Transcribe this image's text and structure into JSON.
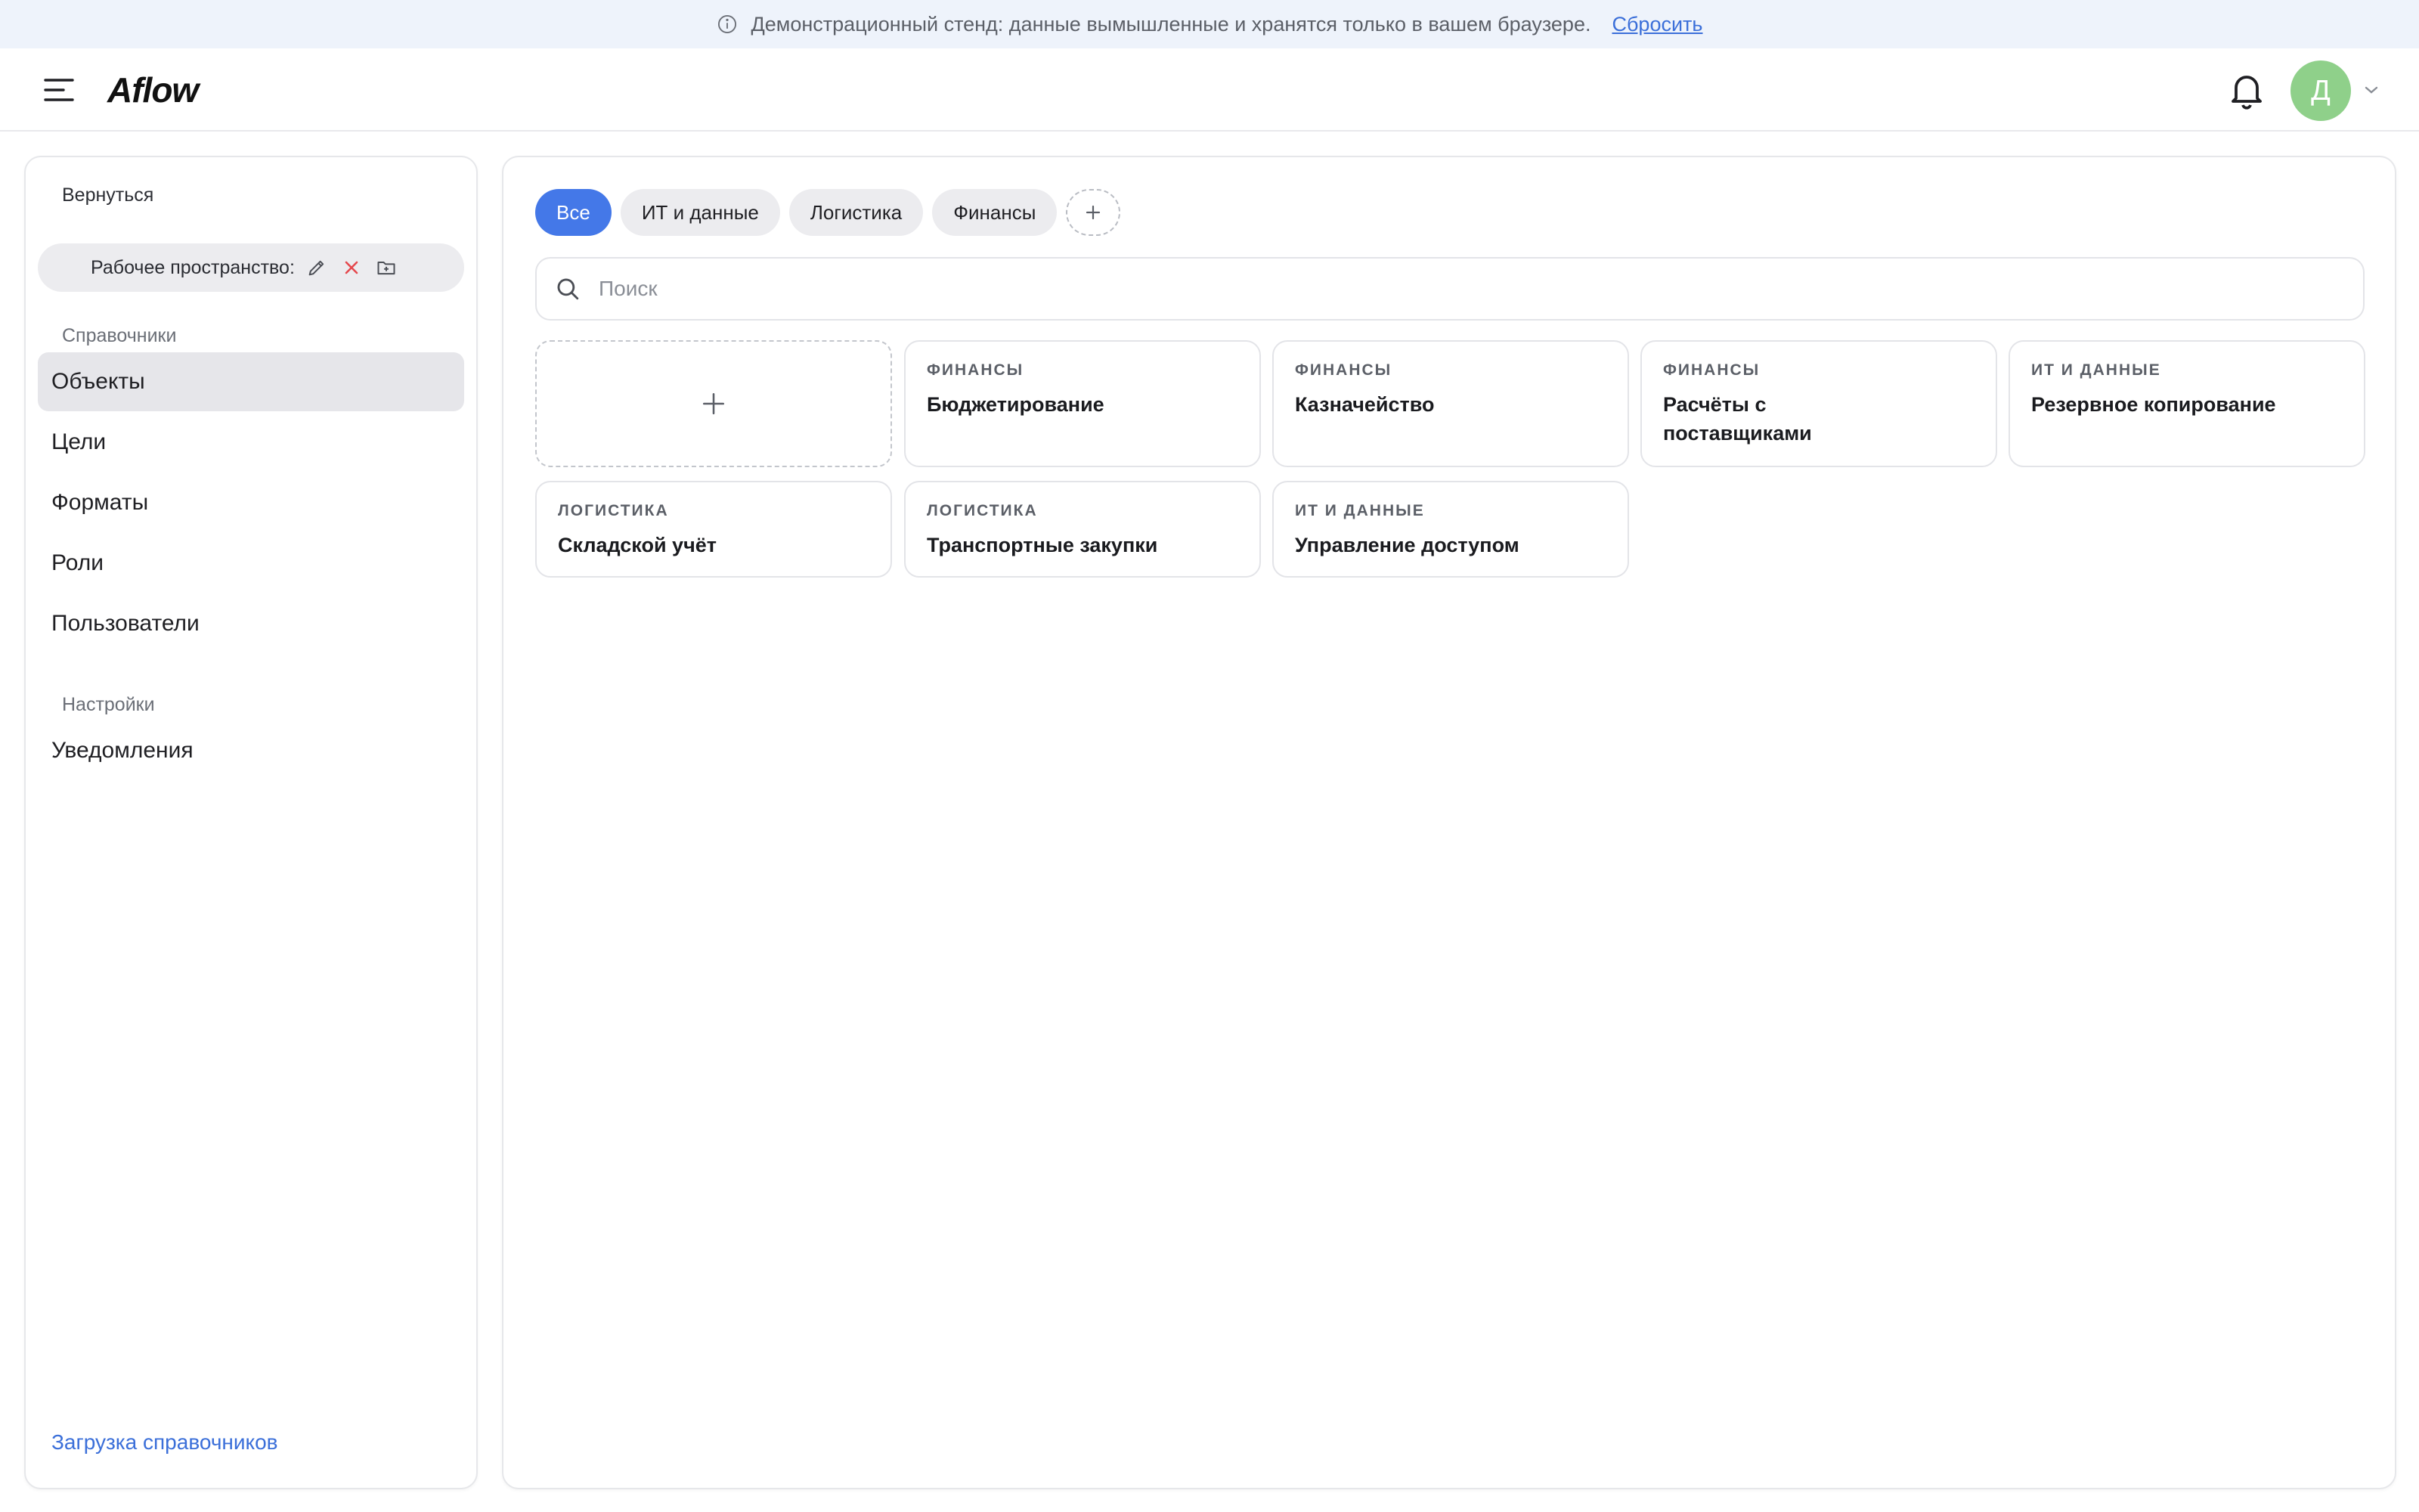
{
  "banner": {
    "text": "Демонстрационный стенд: данные вымышленные и хранятся только в вашем браузере.",
    "reset_label": "Сбросить"
  },
  "header": {
    "logo": "Aflow",
    "avatar_initial": "Д"
  },
  "sidebar": {
    "back_label": "Вернуться",
    "workspace_label": "Рабочее пространство:",
    "section_directories": "Справочники",
    "items": [
      {
        "label": "Объекты",
        "active": true
      },
      {
        "label": "Цели"
      },
      {
        "label": "Форматы"
      },
      {
        "label": "Роли"
      },
      {
        "label": "Пользователи"
      }
    ],
    "section_settings": "Настройки",
    "settings_items": [
      {
        "label": "Уведомления"
      }
    ],
    "upload_label": "Загрузка справочников"
  },
  "main": {
    "tabs": [
      {
        "label": "Все",
        "active": true
      },
      {
        "label": "ИТ и данные"
      },
      {
        "label": "Логистика"
      },
      {
        "label": "Финансы"
      }
    ],
    "search_placeholder": "Поиск",
    "cards": [
      {
        "category": "Финансы",
        "title": "Бюджетирование"
      },
      {
        "category": "Финансы",
        "title": "Казначейство"
      },
      {
        "category": "Финансы",
        "title": "Расчёты с поставщиками"
      },
      {
        "category": "ИТ и данные",
        "title": "Резервное копирование"
      },
      {
        "category": "Логистика",
        "title": "Складской учёт"
      },
      {
        "category": "Логистика",
        "title": "Транспортные закупки"
      },
      {
        "category": "ИТ и данные",
        "title": "Управление доступом"
      }
    ]
  },
  "colors": {
    "accent": "#4478e8",
    "link": "#3b6fd9",
    "avatar": "#8fd08a",
    "delete": "#e5484d"
  }
}
